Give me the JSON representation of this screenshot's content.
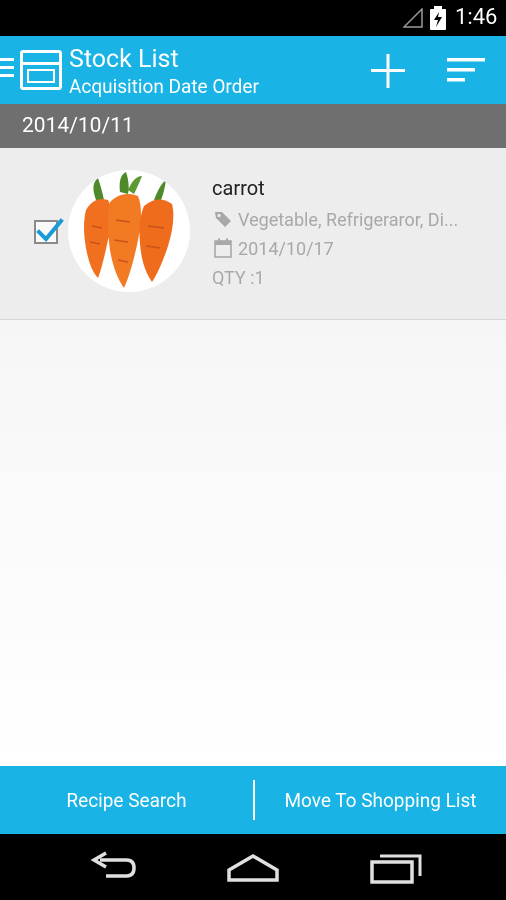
{
  "status_bar": {
    "time": "1:46",
    "icons": [
      "signal-icon",
      "battery-charging-icon"
    ]
  },
  "action_bar": {
    "title": "Stock List",
    "subtitle": "Acquisition Date Order",
    "actions": [
      "add-icon",
      "sort-icon"
    ]
  },
  "section": {
    "date": "2014/10/11"
  },
  "items": [
    {
      "name": "carrot",
      "tags": "Vegetable, Refrigeraror, Di...",
      "date": "2014/10/17",
      "qty": "QTY :1",
      "checked": true,
      "image": "carrot-image"
    }
  ],
  "bottom_bar": {
    "left_label": "Recipe Search",
    "right_label": "Move To Shopping List"
  },
  "nav_bar": {
    "icons": [
      "back-icon",
      "home-icon",
      "recents-icon"
    ]
  },
  "colors": {
    "accent": "#19b3e6",
    "section_header": "#6f6f6f",
    "check": "#1a9bd7"
  }
}
